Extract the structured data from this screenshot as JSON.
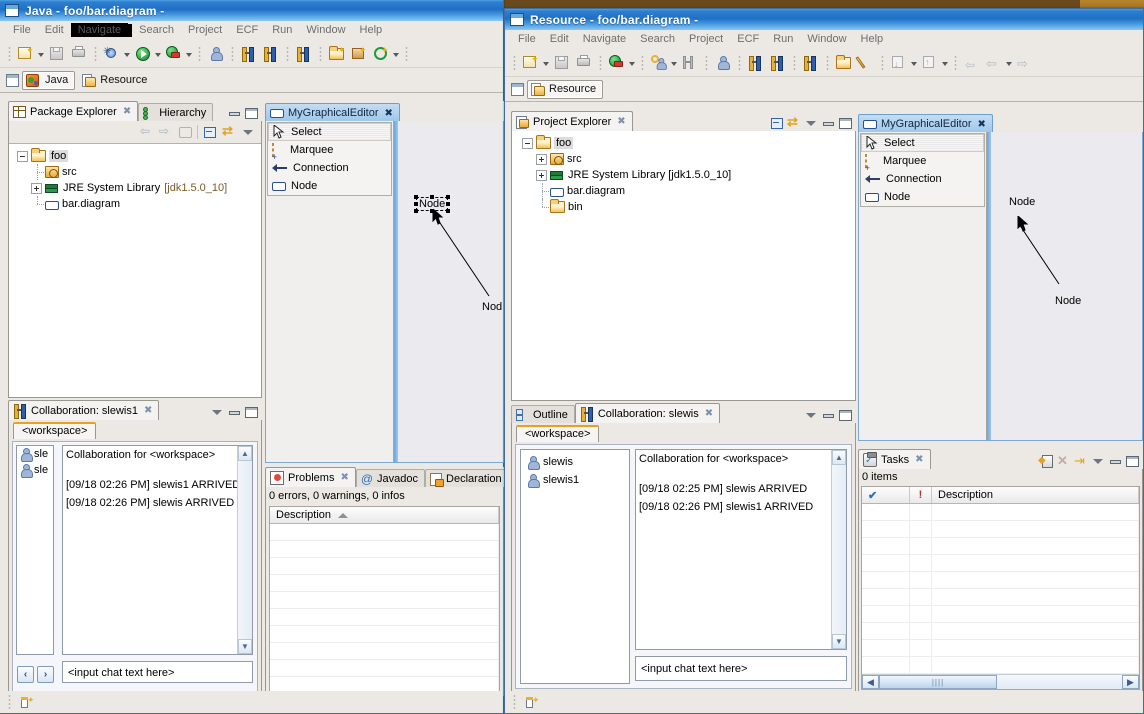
{
  "left_window": {
    "title": "Java - foo/bar.diagram -",
    "window_icon": "window-icon",
    "menus": [
      "File",
      "Edit",
      "Navigate",
      "Search",
      "Project",
      "ECF",
      "Run",
      "Window",
      "Help"
    ],
    "active_menu": "Navigate",
    "perspectives": [
      {
        "label": "Java",
        "icon": "java-perspective-icon",
        "selected": true
      },
      {
        "label": "Resource",
        "icon": "resource-perspective-icon",
        "selected": false
      }
    ],
    "package_explorer": {
      "tabs": [
        {
          "label": "Package Explorer",
          "icon": "package-explorer-icon",
          "selected": true,
          "closeable": true
        },
        {
          "label": "Hierarchy",
          "icon": "hierarchy-icon",
          "selected": false,
          "closeable": false
        }
      ],
      "toolbar_icons": [
        "back-icon",
        "forward-icon",
        "home-icon",
        "collapse-all-icon",
        "link-with-editor-icon",
        "view-menu-icon"
      ],
      "tree": [
        {
          "label": "foo",
          "icon": "folder-open-icon",
          "depth": 0,
          "expander": "minus",
          "selected": true
        },
        {
          "label": "src",
          "icon": "package-icon",
          "depth": 1,
          "expander": "none"
        },
        {
          "label": "JRE System Library",
          "suffix": "[jdk1.5.0_10]",
          "icon": "jre-library-icon",
          "depth": 1,
          "expander": "plus"
        },
        {
          "label": "bar.diagram",
          "icon": "diagram-file-icon",
          "depth": 1,
          "expander": "none"
        }
      ]
    },
    "editor": {
      "tab_label": "MyGraphicalEditor",
      "tab_icon": "diagram-editor-icon",
      "palette": [
        {
          "label": "Select",
          "icon": "select-cursor-icon",
          "selected": true
        },
        {
          "label": "Marquee",
          "icon": "marquee-icon",
          "selected": false
        },
        {
          "label": "Connection",
          "icon": "connection-arrow-icon",
          "selected": false
        },
        {
          "label": "Node",
          "icon": "node-shape-icon",
          "selected": false
        }
      ],
      "nodes": [
        {
          "label": "Node",
          "selected": true
        },
        {
          "label": "Nod",
          "selected": false
        }
      ]
    },
    "collaboration": {
      "tab_label": "Collaboration: slewis1",
      "tab_icon": "collaboration-icon",
      "chat_tab": "<workspace>",
      "roster": [
        "sle",
        "sle"
      ],
      "log_title": "Collaboration for <workspace>",
      "log_lines": [
        "[09/18 02:26 PM] slewis1 ARRIVED",
        "[09/18 02:26 PM] slewis ARRIVED"
      ],
      "input_placeholder": "<input chat text here>"
    },
    "problems": {
      "tabs": [
        {
          "label": "Problems",
          "icon": "problems-icon",
          "selected": true,
          "closeable": true
        },
        {
          "label": "Javadoc",
          "icon": "javadoc-icon",
          "selected": false,
          "closeable": false
        },
        {
          "label": "Declaration",
          "icon": "declaration-icon",
          "selected": false,
          "closeable": false
        }
      ],
      "summary": "0 errors, 0 warnings, 0 infos",
      "column_header": "Description",
      "sort_indicator": "sort-ascending-icon"
    }
  },
  "right_window": {
    "title": "Resource - foo/bar.diagram -",
    "window_icon": "window-icon",
    "menus": [
      "File",
      "Edit",
      "Navigate",
      "Search",
      "Project",
      "ECF",
      "Run",
      "Window",
      "Help"
    ],
    "perspectives": [
      {
        "label": "Resource",
        "icon": "resource-perspective-icon",
        "selected": true
      }
    ],
    "project_explorer": {
      "tab_label": "Project Explorer",
      "tab_icon": "project-explorer-icon",
      "toolbar_icons": [
        "collapse-all-icon",
        "link-with-editor-icon",
        "view-menu-icon",
        "minimize-icon",
        "maximize-icon"
      ],
      "tree": [
        {
          "label": "foo",
          "icon": "folder-open-icon",
          "depth": 0,
          "expander": "minus",
          "selected": true
        },
        {
          "label": "src",
          "icon": "package-icon",
          "depth": 1,
          "expander": "plus"
        },
        {
          "label": "JRE System Library [jdk1.5.0_10]",
          "icon": "jre-library-icon",
          "depth": 1,
          "expander": "plus"
        },
        {
          "label": "bar.diagram",
          "icon": "diagram-file-icon",
          "depth": 1,
          "expander": "none"
        },
        {
          "label": "bin",
          "icon": "folder-icon",
          "depth": 1,
          "expander": "none"
        }
      ]
    },
    "editor": {
      "tab_label": "MyGraphicalEditor",
      "tab_icon": "diagram-editor-icon",
      "palette": [
        {
          "label": "Select",
          "icon": "select-cursor-icon",
          "selected": true
        },
        {
          "label": "Marquee",
          "icon": "marquee-icon",
          "selected": false
        },
        {
          "label": "Connection",
          "icon": "connection-arrow-icon",
          "selected": false
        },
        {
          "label": "Node",
          "icon": "node-shape-icon",
          "selected": false
        }
      ],
      "nodes": [
        {
          "label": "Node",
          "selected": false
        },
        {
          "label": "Node",
          "selected": false
        }
      ]
    },
    "collaboration": {
      "tabs": [
        {
          "label": "Outline",
          "icon": "outline-icon",
          "selected": false,
          "closeable": false
        },
        {
          "label": "Collaboration: slewis",
          "icon": "collaboration-icon",
          "selected": true,
          "closeable": true
        }
      ],
      "chat_tab": "<workspace>",
      "roster": [
        "slewis",
        "slewis1"
      ],
      "log_title": "Collaboration for <workspace>",
      "log_lines": [
        "[09/18 02:25 PM] slewis ARRIVED",
        "[09/18 02:26 PM] slewis1 ARRIVED"
      ],
      "input_placeholder": "<input chat text here>"
    },
    "tasks": {
      "tab_label": "Tasks",
      "tab_icon": "tasks-icon",
      "toolbar_icons": [
        "new-task-icon",
        "delete-icon",
        "filter-icon",
        "view-menu-icon",
        "minimize-icon",
        "maximize-icon"
      ],
      "summary": "0 items",
      "columns": [
        "check-column",
        "priority-column",
        "Description"
      ],
      "column_glyphs": [
        "✔",
        "!"
      ],
      "row_count": 10
    }
  },
  "colors": {
    "title_active": "#1f6fc4",
    "chrome": "#ece9e4",
    "tab_selected": "#9dc6ea",
    "canvas": "#ebeaee",
    "background_window": "#a3741f"
  }
}
